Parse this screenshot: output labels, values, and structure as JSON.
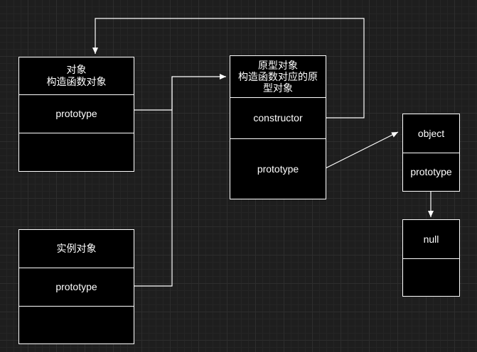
{
  "constructor_box": {
    "title_line1": "对象",
    "title_line2": "构造函数对象",
    "field_prototype": "prototype",
    "field_empty": ""
  },
  "prototype_box": {
    "title_line1": "原型对象",
    "title_line2": "构造函数对应的原",
    "title_line3": "型对象",
    "field_constructor": "constructor",
    "field_prototype": "prototype"
  },
  "instance_box": {
    "title": "实例对象",
    "field_prototype": "prototype",
    "field_empty": ""
  },
  "object_box": {
    "title": "object",
    "field_prototype": "prototype"
  },
  "null_box": {
    "title": "null",
    "field_empty": ""
  }
}
